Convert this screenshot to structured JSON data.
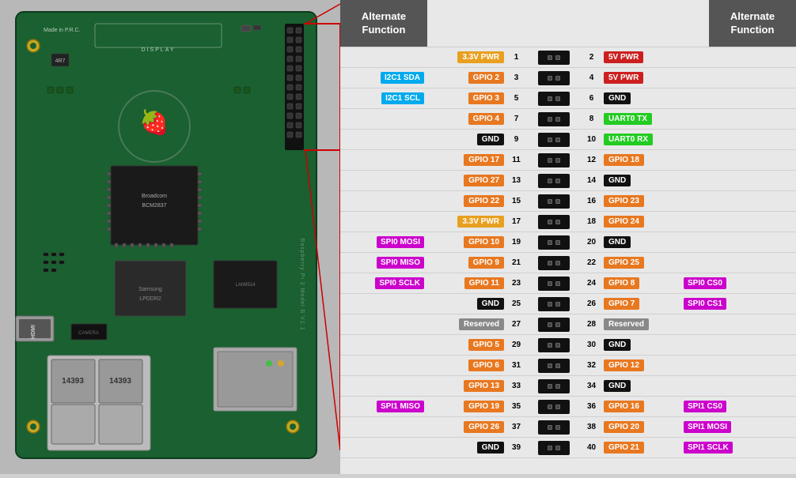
{
  "header": {
    "left_alt_func": "Alternate\nFunction",
    "right_alt_func": "Alternate\nFunction"
  },
  "pins": [
    {
      "left_alt": "",
      "left_alt_color": "",
      "left_name": "3.3V PWR",
      "left_color": "color-33v",
      "left_num": "1",
      "right_num": "2",
      "right_name": "5V PWR",
      "right_color": "color-5v",
      "right_alt": "",
      "right_alt_color": ""
    },
    {
      "left_alt": "I2C1 SDA",
      "left_alt_color": "color-i2c",
      "left_name": "GPIO 2",
      "left_color": "color-gpio",
      "left_num": "3",
      "right_num": "4",
      "right_name": "5V PWR",
      "right_color": "color-5v",
      "right_alt": "",
      "right_alt_color": ""
    },
    {
      "left_alt": "I2C1 SCL",
      "left_alt_color": "color-i2c",
      "left_name": "GPIO 3",
      "left_color": "color-gpio",
      "left_num": "5",
      "right_num": "6",
      "right_name": "GND",
      "right_color": "color-gnd",
      "right_alt": "",
      "right_alt_color": ""
    },
    {
      "left_alt": "",
      "left_alt_color": "",
      "left_name": "GPIO 4",
      "left_color": "color-gpio",
      "left_num": "7",
      "right_num": "8",
      "right_name": "UART0 TX",
      "right_color": "color-uart",
      "right_alt": "",
      "right_alt_color": ""
    },
    {
      "left_alt": "",
      "left_alt_color": "",
      "left_name": "GND",
      "left_color": "color-gnd",
      "left_num": "9",
      "right_num": "10",
      "right_name": "UART0 RX",
      "right_color": "color-uart",
      "right_alt": "",
      "right_alt_color": ""
    },
    {
      "left_alt": "",
      "left_alt_color": "",
      "left_name": "GPIO 17",
      "left_color": "color-gpio",
      "left_num": "11",
      "right_num": "12",
      "right_name": "GPIO 18",
      "right_color": "color-gpio",
      "right_alt": "",
      "right_alt_color": ""
    },
    {
      "left_alt": "",
      "left_alt_color": "",
      "left_name": "GPIO 27",
      "left_color": "color-gpio",
      "left_num": "13",
      "right_num": "14",
      "right_name": "GND",
      "right_color": "color-gnd",
      "right_alt": "",
      "right_alt_color": ""
    },
    {
      "left_alt": "",
      "left_alt_color": "",
      "left_name": "GPIO 22",
      "left_color": "color-gpio",
      "left_num": "15",
      "right_num": "16",
      "right_name": "GPIO 23",
      "right_color": "color-gpio",
      "right_alt": "",
      "right_alt_color": ""
    },
    {
      "left_alt": "",
      "left_alt_color": "",
      "left_name": "3.3V PWR",
      "left_color": "color-33v",
      "left_num": "17",
      "right_num": "18",
      "right_name": "GPIO 24",
      "right_color": "color-gpio",
      "right_alt": "",
      "right_alt_color": ""
    },
    {
      "left_alt": "SPI0 MOSI",
      "left_alt_color": "color-spi",
      "left_name": "GPIO 10",
      "left_color": "color-gpio",
      "left_num": "19",
      "right_num": "20",
      "right_name": "GND",
      "right_color": "color-gnd",
      "right_alt": "",
      "right_alt_color": ""
    },
    {
      "left_alt": "SPI0 MISO",
      "left_alt_color": "color-spi",
      "left_name": "GPIO 9",
      "left_color": "color-gpio",
      "left_num": "21",
      "right_num": "22",
      "right_name": "GPIO 25",
      "right_color": "color-gpio",
      "right_alt": "",
      "right_alt_color": ""
    },
    {
      "left_alt": "SPI0 SCLK",
      "left_alt_color": "color-spi",
      "left_name": "GPIO 11",
      "left_color": "color-gpio",
      "left_num": "23",
      "right_num": "24",
      "right_name": "GPIO 8",
      "right_color": "color-gpio",
      "right_alt": "SPI0 CS0",
      "right_alt_color": "color-spi"
    },
    {
      "left_alt": "",
      "left_alt_color": "",
      "left_name": "GND",
      "left_color": "color-gnd",
      "left_num": "25",
      "right_num": "26",
      "right_name": "GPIO 7",
      "right_color": "color-gpio",
      "right_alt": "SPI0 CS1",
      "right_alt_color": "color-spi"
    },
    {
      "left_alt": "",
      "left_alt_color": "",
      "left_name": "Reserved",
      "left_color": "color-reserved",
      "left_num": "27",
      "right_num": "28",
      "right_name": "Reserved",
      "right_color": "color-reserved",
      "right_alt": "",
      "right_alt_color": ""
    },
    {
      "left_alt": "",
      "left_alt_color": "",
      "left_name": "GPIO 5",
      "left_color": "color-gpio",
      "left_num": "29",
      "right_num": "30",
      "right_name": "GND",
      "right_color": "color-gnd",
      "right_alt": "",
      "right_alt_color": ""
    },
    {
      "left_alt": "",
      "left_alt_color": "",
      "left_name": "GPIO 6",
      "left_color": "color-gpio",
      "left_num": "31",
      "right_num": "32",
      "right_name": "GPIO 12",
      "right_color": "color-gpio",
      "right_alt": "",
      "right_alt_color": ""
    },
    {
      "left_alt": "",
      "left_alt_color": "",
      "left_name": "GPIO 13",
      "left_color": "color-gpio",
      "left_num": "33",
      "right_num": "34",
      "right_name": "GND",
      "right_color": "color-gnd",
      "right_alt": "",
      "right_alt_color": ""
    },
    {
      "left_alt": "SPI1 MISO",
      "left_alt_color": "color-spi",
      "left_name": "GPIO 19",
      "left_color": "color-gpio",
      "left_num": "35",
      "right_num": "36",
      "right_name": "GPIO 16",
      "right_color": "color-gpio",
      "right_alt": "SPI1 CS0",
      "right_alt_color": "color-spi"
    },
    {
      "left_alt": "",
      "left_alt_color": "",
      "left_name": "GPIO 26",
      "left_color": "color-gpio",
      "left_num": "37",
      "right_num": "38",
      "right_name": "GPIO 20",
      "right_color": "color-gpio",
      "right_alt": "SPI1 MOSI",
      "right_alt_color": "color-spi"
    },
    {
      "left_alt": "",
      "left_alt_color": "",
      "left_name": "GND",
      "left_color": "color-gnd",
      "left_num": "39",
      "right_num": "40",
      "right_name": "GPIO 21",
      "right_color": "color-gpio",
      "right_alt": "SPI1 SCLK",
      "right_alt_color": "color-spi"
    }
  ]
}
